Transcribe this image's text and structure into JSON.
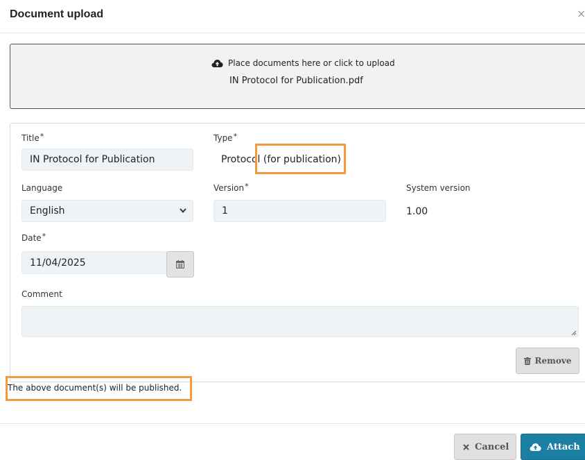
{
  "dialog": {
    "title": "Document upload",
    "close_glyph": "×"
  },
  "dropzone": {
    "icon": "cloud-upload-icon",
    "instruction": "Place documents here or click to upload",
    "file_name": "IN Protocol for Publication.pdf"
  },
  "document": {
    "title_label": "Title",
    "title_value": "IN Protocol for Publication",
    "type_label": "Type",
    "type_value": "Protocol (for publication)",
    "language_label": "Language",
    "language_value": "English",
    "version_label": "Version",
    "version_value": "1",
    "system_version_label": "System version",
    "system_version_value": "1.00",
    "date_label": "Date",
    "date_value": "11/04/2025",
    "comment_label": "Comment",
    "comment_value": "",
    "required_mark": "*",
    "remove_label": "Remove"
  },
  "notice": "The above document(s) will be published.",
  "footer": {
    "cancel_label": "Cancel",
    "attach_label": "Attach"
  },
  "colors": {
    "accent": "#1b7fa3",
    "highlight": "#f29b3c"
  }
}
